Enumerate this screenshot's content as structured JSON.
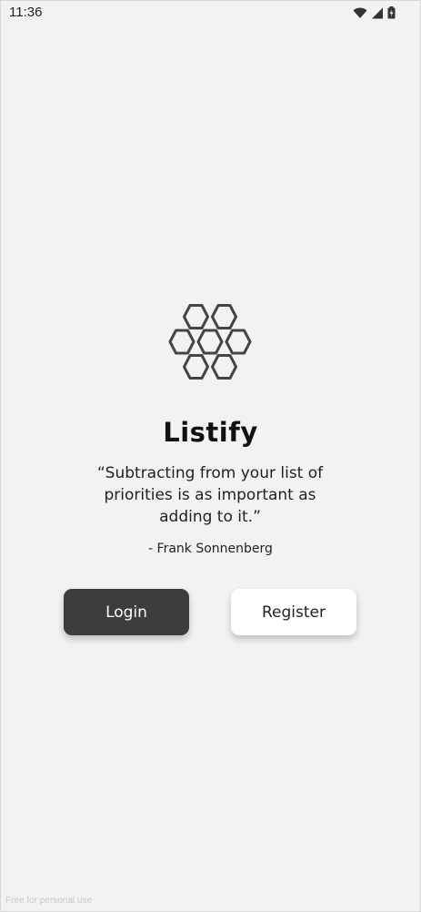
{
  "status_bar": {
    "time": "11:36",
    "icons": [
      "wifi-icon",
      "signal-icon",
      "battery-icon"
    ]
  },
  "app": {
    "logo": "honeycomb-icon",
    "title": "Listify",
    "quote": "“Subtracting from your list of priorities is as important as adding to it.”",
    "author": "- Frank Sonnenberg"
  },
  "buttons": {
    "login_label": "Login",
    "register_label": "Register"
  },
  "watermark": "Free for personal use",
  "colors": {
    "background": "#f2f2f2",
    "login_button": "#3f3c3e",
    "register_button": "#ffffff",
    "logo_stroke": "#444444"
  }
}
